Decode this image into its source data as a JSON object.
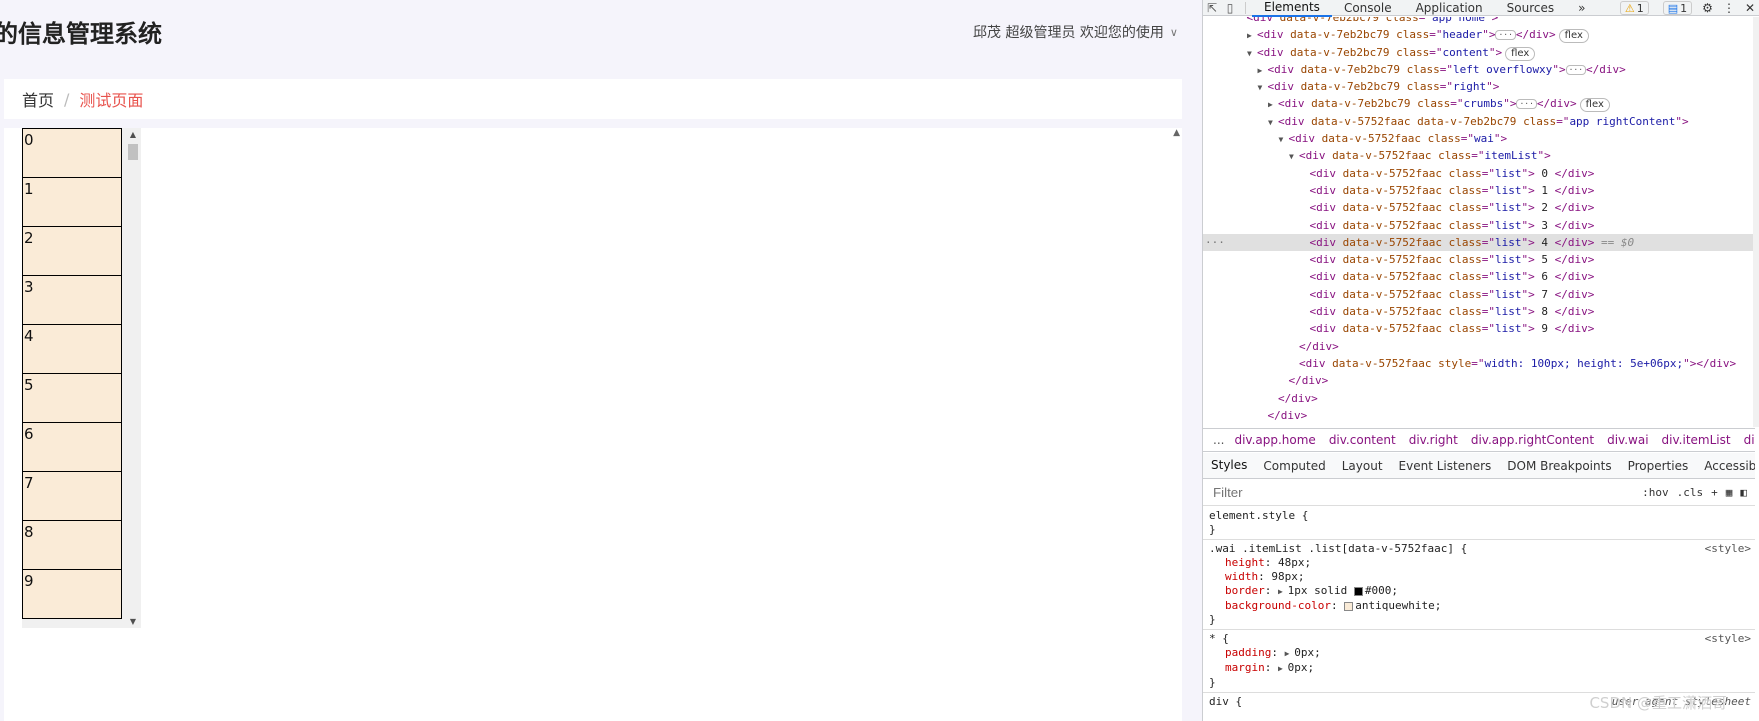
{
  "app": {
    "title": "的信息管理系统",
    "user_text": "邱茂 超级管理员 欢迎您的使用",
    "breadcrumb": {
      "home": "首页",
      "separator": "/",
      "current": "测试页面"
    },
    "list_items": [
      "0",
      "1",
      "2",
      "3",
      "4",
      "5",
      "6",
      "7",
      "8",
      "9"
    ]
  },
  "devtools": {
    "tabs": [
      "Elements",
      "Console",
      "Application",
      "Sources"
    ],
    "more": "»",
    "warn_count": "1",
    "info_count": "1",
    "dom_lines": [
      {
        "indent": 3,
        "tw": "",
        "tag": "<div",
        "attrs": [
          [
            "data-v-7eb2bc79",
            ""
          ],
          [
            "class",
            "app home"
          ]
        ],
        "tail": ">",
        "extra": "",
        "cut": true
      },
      {
        "indent": 4,
        "tw": "▶",
        "tag": "<div",
        "attrs": [
          [
            "data-v-7eb2bc79",
            ""
          ],
          [
            "class",
            "header"
          ]
        ],
        "tail": ">",
        "extra": "ellip",
        "close": "</div>",
        "pill": "flex"
      },
      {
        "indent": 4,
        "tw": "▼",
        "tag": "<div",
        "attrs": [
          [
            "data-v-7eb2bc79",
            ""
          ],
          [
            "class",
            "content"
          ]
        ],
        "tail": ">",
        "pill": "flex"
      },
      {
        "indent": 5,
        "tw": "▶",
        "tag": "<div",
        "attrs": [
          [
            "data-v-7eb2bc79",
            ""
          ],
          [
            "class",
            "left overflowxy"
          ]
        ],
        "tail": ">",
        "extra": "ellip",
        "close": "</div>"
      },
      {
        "indent": 5,
        "tw": "▼",
        "tag": "<div",
        "attrs": [
          [
            "data-v-7eb2bc79",
            ""
          ],
          [
            "class",
            "right"
          ]
        ],
        "tail": ">"
      },
      {
        "indent": 6,
        "tw": "▶",
        "tag": "<div",
        "attrs": [
          [
            "data-v-7eb2bc79",
            ""
          ],
          [
            "class",
            "crumbs"
          ]
        ],
        "tail": ">",
        "extra": "ellip",
        "close": "</div>",
        "pill": "flex"
      },
      {
        "indent": 6,
        "tw": "▼",
        "tag": "<div",
        "attrs": [
          [
            "data-v-5752faac",
            ""
          ],
          [
            "data-v-7eb2bc79",
            ""
          ],
          [
            "class",
            "app rightContent"
          ]
        ],
        "tail": ">"
      },
      {
        "indent": 7,
        "tw": "▼",
        "tag": "<div",
        "attrs": [
          [
            "data-v-5752faac",
            ""
          ],
          [
            "class",
            "wai"
          ]
        ],
        "tail": ">"
      },
      {
        "indent": 8,
        "tw": "▼",
        "tag": "<div",
        "attrs": [
          [
            "data-v-5752faac",
            ""
          ],
          [
            "class",
            "itemList"
          ]
        ],
        "tail": ">"
      },
      {
        "indent": 9,
        "tw": "",
        "tag": "<div",
        "attrs": [
          [
            "data-v-5752faac",
            ""
          ],
          [
            "class",
            "list"
          ]
        ],
        "tail": ">",
        "text": " 0 ",
        "close": "</div>"
      },
      {
        "indent": 9,
        "tw": "",
        "tag": "<div",
        "attrs": [
          [
            "data-v-5752faac",
            ""
          ],
          [
            "class",
            "list"
          ]
        ],
        "tail": ">",
        "text": " 1 ",
        "close": "</div>"
      },
      {
        "indent": 9,
        "tw": "",
        "tag": "<div",
        "attrs": [
          [
            "data-v-5752faac",
            ""
          ],
          [
            "class",
            "list"
          ]
        ],
        "tail": ">",
        "text": " 2 ",
        "close": "</div>"
      },
      {
        "indent": 9,
        "tw": "",
        "tag": "<div",
        "attrs": [
          [
            "data-v-5752faac",
            ""
          ],
          [
            "class",
            "list"
          ]
        ],
        "tail": ">",
        "text": " 3 ",
        "close": "</div>"
      },
      {
        "indent": 9,
        "tw": "",
        "tag": "<div",
        "attrs": [
          [
            "data-v-5752faac",
            ""
          ],
          [
            "class",
            "list"
          ]
        ],
        "tail": ">",
        "text": " 4 ",
        "close": "</div>",
        "selected": true,
        "eq": " == $0"
      },
      {
        "indent": 9,
        "tw": "",
        "tag": "<div",
        "attrs": [
          [
            "data-v-5752faac",
            ""
          ],
          [
            "class",
            "list"
          ]
        ],
        "tail": ">",
        "text": " 5 ",
        "close": "</div>"
      },
      {
        "indent": 9,
        "tw": "",
        "tag": "<div",
        "attrs": [
          [
            "data-v-5752faac",
            ""
          ],
          [
            "class",
            "list"
          ]
        ],
        "tail": ">",
        "text": " 6 ",
        "close": "</div>"
      },
      {
        "indent": 9,
        "tw": "",
        "tag": "<div",
        "attrs": [
          [
            "data-v-5752faac",
            ""
          ],
          [
            "class",
            "list"
          ]
        ],
        "tail": ">",
        "text": " 7 ",
        "close": "</div>"
      },
      {
        "indent": 9,
        "tw": "",
        "tag": "<div",
        "attrs": [
          [
            "data-v-5752faac",
            ""
          ],
          [
            "class",
            "list"
          ]
        ],
        "tail": ">",
        "text": " 8 ",
        "close": "</div>"
      },
      {
        "indent": 9,
        "tw": "",
        "tag": "<div",
        "attrs": [
          [
            "data-v-5752faac",
            ""
          ],
          [
            "class",
            "list"
          ]
        ],
        "tail": ">",
        "text": " 9 ",
        "close": "</div>"
      },
      {
        "indent": 8,
        "tw": "",
        "tag": "</div>",
        "attrs": [],
        "tail": ""
      },
      {
        "indent": 8,
        "tw": "",
        "tag": "<div",
        "attrs": [
          [
            "data-v-5752faac",
            ""
          ],
          [
            "style",
            "width: 100px; height: 5e+06px;"
          ]
        ],
        "tail": ">",
        "close": "</div>"
      },
      {
        "indent": 7,
        "tw": "",
        "tag": "</div>",
        "attrs": [],
        "tail": ""
      },
      {
        "indent": 6,
        "tw": "",
        "tag": "</div>",
        "attrs": [],
        "tail": ""
      },
      {
        "indent": 5,
        "tw": "",
        "tag": "</div>",
        "attrs": [],
        "tail": ""
      }
    ],
    "breadcrumb": [
      "...",
      "div.app.home",
      "div.content",
      "div.right",
      "div.app.rightContent",
      "div.wai",
      "div.itemList",
      "div.list",
      "..."
    ],
    "subtabs": [
      "Styles",
      "Computed",
      "Layout",
      "Event Listeners",
      "DOM Breakpoints",
      "Properties",
      "Accessibility"
    ],
    "filter": {
      "placeholder": "Filter",
      "hov": ":hov",
      "cls": ".cls",
      "plus": "+"
    },
    "styles": {
      "element_style": "element.style {",
      "close": "}",
      "rule1_selector": ".wai .itemList .list[data-v-5752faac] {",
      "rule1_source": "<style>",
      "rule1_decls": [
        {
          "prop": "height",
          "val": "48px;"
        },
        {
          "prop": "width",
          "val": "98px;"
        },
        {
          "prop": "border",
          "val": "1px solid #000;",
          "caret": true,
          "swatch": "#000000"
        },
        {
          "prop": "background-color",
          "val": "antiquewhite;",
          "swatch": "#faebd7"
        }
      ],
      "rule2_selector": "* {",
      "rule2_source": "<style>",
      "rule2_decls": [
        {
          "prop": "padding",
          "val": "0px;",
          "caret": true
        },
        {
          "prop": "margin",
          "val": "0px;",
          "caret": true
        }
      ],
      "rule3_selector": "div {",
      "rule3_source": "user agent stylesheet"
    },
    "watermark": "CSDN @重工潇洒哥"
  }
}
